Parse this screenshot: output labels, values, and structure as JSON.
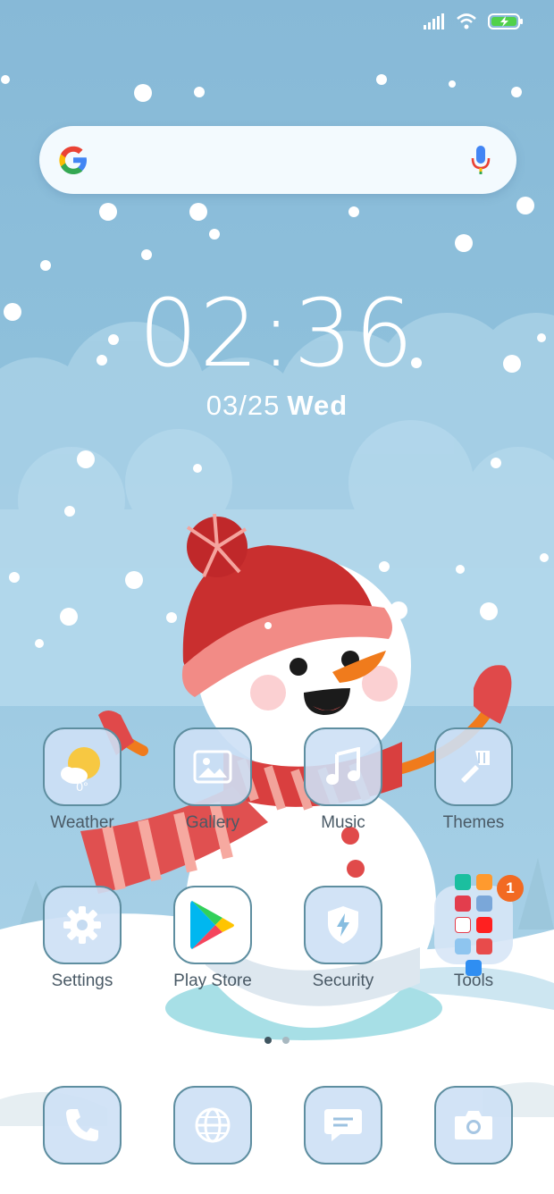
{
  "status_bar": {
    "signal": "signal-icon",
    "wifi": "wifi-icon",
    "battery": "battery-charging-icon"
  },
  "search": {
    "logo": "google-g-icon",
    "voice": "mic-icon",
    "colors": {
      "blue": "#4285F4",
      "red": "#EA4335",
      "yellow": "#FBBC05",
      "green": "#34A853"
    }
  },
  "clock": {
    "time": "02:36",
    "date": "03/25",
    "weekday": "Wed"
  },
  "apps_row1": [
    {
      "label": "Weather",
      "icon": "weather-sun-cloud-icon",
      "temp": "0°"
    },
    {
      "label": "Gallery",
      "icon": "gallery-image-icon"
    },
    {
      "label": "Music",
      "icon": "music-note-icon"
    },
    {
      "label": "Themes",
      "icon": "paintbrush-icon"
    }
  ],
  "apps_row2": [
    {
      "label": "Settings",
      "icon": "gear-icon"
    },
    {
      "label": "Play Store",
      "icon": "play-store-icon"
    },
    {
      "label": "Security",
      "icon": "shield-bolt-icon"
    },
    {
      "label": "Tools",
      "icon": "folder-icon",
      "badge": "1"
    }
  ],
  "pager": {
    "pages": 2,
    "current": 1
  },
  "dock": [
    {
      "icon": "phone-icon"
    },
    {
      "icon": "browser-globe-icon"
    },
    {
      "icon": "messages-icon"
    },
    {
      "icon": "camera-icon"
    }
  ],
  "colors": {
    "sky": "#8fc1dc",
    "snow": "#ffffff",
    "accent_badge": "#f26a22",
    "tile_border": "#5e8ea0"
  }
}
